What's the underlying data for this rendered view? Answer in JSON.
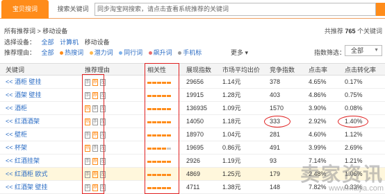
{
  "tabs": [
    {
      "label": "宝贝搜词",
      "active": true
    },
    {
      "label": "搜索关键词",
      "active": false
    }
  ],
  "search": {
    "placeholder": "同步淘宝网搜索，请点击查看系统推荐的关键词"
  },
  "breadcrumb": {
    "root": "所有推荐词",
    "sep": " > ",
    "current": "移动设备"
  },
  "total": {
    "prefix": "共推荐",
    "count": "765",
    "suffix": "个关键词"
  },
  "device_filter": {
    "label": "选择设备：",
    "options": [
      "全部",
      "计算机",
      "移动设备"
    ],
    "selected": "移动设备"
  },
  "reason_filter": {
    "label": "推荐理由：",
    "options": [
      "全部",
      "热搜词",
      "潜力词",
      "同行词",
      "飙升词",
      "手机标"
    ],
    "more": "更多"
  },
  "index_filter": {
    "label": "指数筛选：",
    "value": "全部"
  },
  "columns": {
    "keyword": "关键词",
    "reason": "推荐理由",
    "relevance": "相关性",
    "display_index": "展现指数",
    "avg_price": "市场平均出价",
    "competition": "竞争指数",
    "ctr": "点击率",
    "cvr": "点击转化率"
  },
  "rows": [
    {
      "keyword": "<< 酒柜 壁挂",
      "badges": [
        "手",
        "荐",
        "左"
      ],
      "relevance": 5,
      "display": "29656",
      "price": "1.14元",
      "comp": "378",
      "ctr": "4.65%",
      "cvr": "0.17%",
      "hl": false
    },
    {
      "keyword": "<< 酒架 壁挂",
      "badges": [
        "手",
        "荐",
        "左"
      ],
      "relevance": 5,
      "display": "19915",
      "price": "1.28元",
      "comp": "403",
      "ctr": "4.86%",
      "cvr": "0.75%",
      "hl": false
    },
    {
      "keyword": "<< 酒柜",
      "badges": [
        "热",
        "手",
        "左"
      ],
      "relevance": 5,
      "display": "136935",
      "price": "1.09元",
      "comp": "1570",
      "ctr": "3.90%",
      "cvr": "0.08%",
      "hl": false
    },
    {
      "keyword": "<< 红酒酒架",
      "badges": [
        "热",
        "手",
        "左"
      ],
      "relevance": 5,
      "display": "14050",
      "price": "1.18元",
      "comp": "333",
      "ctr": "2.92%",
      "cvr": "1.40%",
      "hl": false
    },
    {
      "keyword": "<< 壁柜",
      "badges": [
        "手",
        "荐",
        "左"
      ],
      "relevance": 5,
      "display": "18970",
      "price": "1.04元",
      "comp": "281",
      "ctr": "4.60%",
      "cvr": "1.12%",
      "hl": false
    },
    {
      "keyword": "<< 杯架",
      "badges": [
        "热",
        "手",
        "左"
      ],
      "relevance": 4,
      "display": "19695",
      "price": "0.86元",
      "comp": "491",
      "ctr": "3.99%",
      "cvr": "2.69%",
      "hl": false
    },
    {
      "keyword": "<< 红酒挂架",
      "badges": [
        "手",
        "荐",
        "左"
      ],
      "relevance": 5,
      "display": "2926",
      "price": "1.19元",
      "comp": "93",
      "ctr": "7.14%",
      "cvr": "1.21%",
      "hl": false
    },
    {
      "keyword": "<< 红酒柜 欧式",
      "badges": [
        "手",
        "荐",
        "左"
      ],
      "relevance": 5,
      "display": "4869",
      "price": "1.25元",
      "comp": "179",
      "ctr": "2.48%",
      "cvr": "1.06%",
      "hl": true
    },
    {
      "keyword": "<< 红酒架 壁挂",
      "badges": [
        "手",
        "荐",
        "左"
      ],
      "relevance": 5,
      "display": "4711",
      "price": "1.38元",
      "comp": "148",
      "ctr": "7.82%",
      "cvr": "0.33%",
      "hl": false
    }
  ],
  "watermark": {
    "big": "卖家资讯",
    "small": "www.maijia.com"
  },
  "colors": {
    "accent": "#ff8c1a",
    "link": "#2b6cc4",
    "annotation": "#e02020"
  }
}
